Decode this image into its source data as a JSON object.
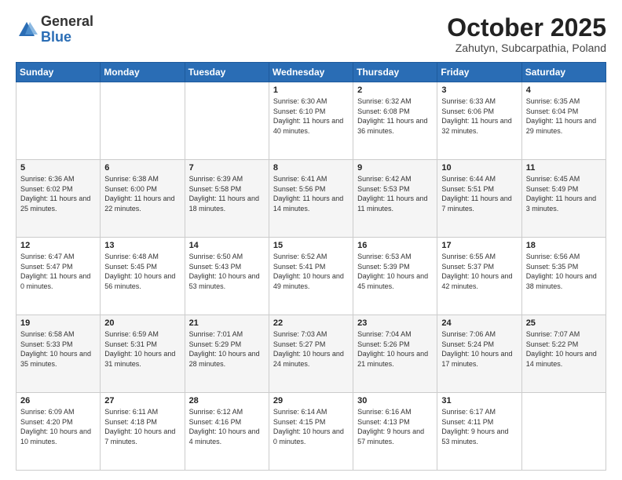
{
  "logo": {
    "general": "General",
    "blue": "Blue"
  },
  "header": {
    "month": "October 2025",
    "location": "Zahutyn, Subcarpathia, Poland"
  },
  "weekdays": [
    "Sunday",
    "Monday",
    "Tuesday",
    "Wednesday",
    "Thursday",
    "Friday",
    "Saturday"
  ],
  "weeks": [
    [
      {
        "day": "",
        "info": ""
      },
      {
        "day": "",
        "info": ""
      },
      {
        "day": "",
        "info": ""
      },
      {
        "day": "1",
        "info": "Sunrise: 6:30 AM\nSunset: 6:10 PM\nDaylight: 11 hours\nand 40 minutes."
      },
      {
        "day": "2",
        "info": "Sunrise: 6:32 AM\nSunset: 6:08 PM\nDaylight: 11 hours\nand 36 minutes."
      },
      {
        "day": "3",
        "info": "Sunrise: 6:33 AM\nSunset: 6:06 PM\nDaylight: 11 hours\nand 32 minutes."
      },
      {
        "day": "4",
        "info": "Sunrise: 6:35 AM\nSunset: 6:04 PM\nDaylight: 11 hours\nand 29 minutes."
      }
    ],
    [
      {
        "day": "5",
        "info": "Sunrise: 6:36 AM\nSunset: 6:02 PM\nDaylight: 11 hours\nand 25 minutes."
      },
      {
        "day": "6",
        "info": "Sunrise: 6:38 AM\nSunset: 6:00 PM\nDaylight: 11 hours\nand 22 minutes."
      },
      {
        "day": "7",
        "info": "Sunrise: 6:39 AM\nSunset: 5:58 PM\nDaylight: 11 hours\nand 18 minutes."
      },
      {
        "day": "8",
        "info": "Sunrise: 6:41 AM\nSunset: 5:56 PM\nDaylight: 11 hours\nand 14 minutes."
      },
      {
        "day": "9",
        "info": "Sunrise: 6:42 AM\nSunset: 5:53 PM\nDaylight: 11 hours\nand 11 minutes."
      },
      {
        "day": "10",
        "info": "Sunrise: 6:44 AM\nSunset: 5:51 PM\nDaylight: 11 hours\nand 7 minutes."
      },
      {
        "day": "11",
        "info": "Sunrise: 6:45 AM\nSunset: 5:49 PM\nDaylight: 11 hours\nand 3 minutes."
      }
    ],
    [
      {
        "day": "12",
        "info": "Sunrise: 6:47 AM\nSunset: 5:47 PM\nDaylight: 11 hours\nand 0 minutes."
      },
      {
        "day": "13",
        "info": "Sunrise: 6:48 AM\nSunset: 5:45 PM\nDaylight: 10 hours\nand 56 minutes."
      },
      {
        "day": "14",
        "info": "Sunrise: 6:50 AM\nSunset: 5:43 PM\nDaylight: 10 hours\nand 53 minutes."
      },
      {
        "day": "15",
        "info": "Sunrise: 6:52 AM\nSunset: 5:41 PM\nDaylight: 10 hours\nand 49 minutes."
      },
      {
        "day": "16",
        "info": "Sunrise: 6:53 AM\nSunset: 5:39 PM\nDaylight: 10 hours\nand 45 minutes."
      },
      {
        "day": "17",
        "info": "Sunrise: 6:55 AM\nSunset: 5:37 PM\nDaylight: 10 hours\nand 42 minutes."
      },
      {
        "day": "18",
        "info": "Sunrise: 6:56 AM\nSunset: 5:35 PM\nDaylight: 10 hours\nand 38 minutes."
      }
    ],
    [
      {
        "day": "19",
        "info": "Sunrise: 6:58 AM\nSunset: 5:33 PM\nDaylight: 10 hours\nand 35 minutes."
      },
      {
        "day": "20",
        "info": "Sunrise: 6:59 AM\nSunset: 5:31 PM\nDaylight: 10 hours\nand 31 minutes."
      },
      {
        "day": "21",
        "info": "Sunrise: 7:01 AM\nSunset: 5:29 PM\nDaylight: 10 hours\nand 28 minutes."
      },
      {
        "day": "22",
        "info": "Sunrise: 7:03 AM\nSunset: 5:27 PM\nDaylight: 10 hours\nand 24 minutes."
      },
      {
        "day": "23",
        "info": "Sunrise: 7:04 AM\nSunset: 5:26 PM\nDaylight: 10 hours\nand 21 minutes."
      },
      {
        "day": "24",
        "info": "Sunrise: 7:06 AM\nSunset: 5:24 PM\nDaylight: 10 hours\nand 17 minutes."
      },
      {
        "day": "25",
        "info": "Sunrise: 7:07 AM\nSunset: 5:22 PM\nDaylight: 10 hours\nand 14 minutes."
      }
    ],
    [
      {
        "day": "26",
        "info": "Sunrise: 6:09 AM\nSunset: 4:20 PM\nDaylight: 10 hours\nand 10 minutes."
      },
      {
        "day": "27",
        "info": "Sunrise: 6:11 AM\nSunset: 4:18 PM\nDaylight: 10 hours\nand 7 minutes."
      },
      {
        "day": "28",
        "info": "Sunrise: 6:12 AM\nSunset: 4:16 PM\nDaylight: 10 hours\nand 4 minutes."
      },
      {
        "day": "29",
        "info": "Sunrise: 6:14 AM\nSunset: 4:15 PM\nDaylight: 10 hours\nand 0 minutes."
      },
      {
        "day": "30",
        "info": "Sunrise: 6:16 AM\nSunset: 4:13 PM\nDaylight: 9 hours\nand 57 minutes."
      },
      {
        "day": "31",
        "info": "Sunrise: 6:17 AM\nSunset: 4:11 PM\nDaylight: 9 hours\nand 53 minutes."
      },
      {
        "day": "",
        "info": ""
      }
    ]
  ]
}
